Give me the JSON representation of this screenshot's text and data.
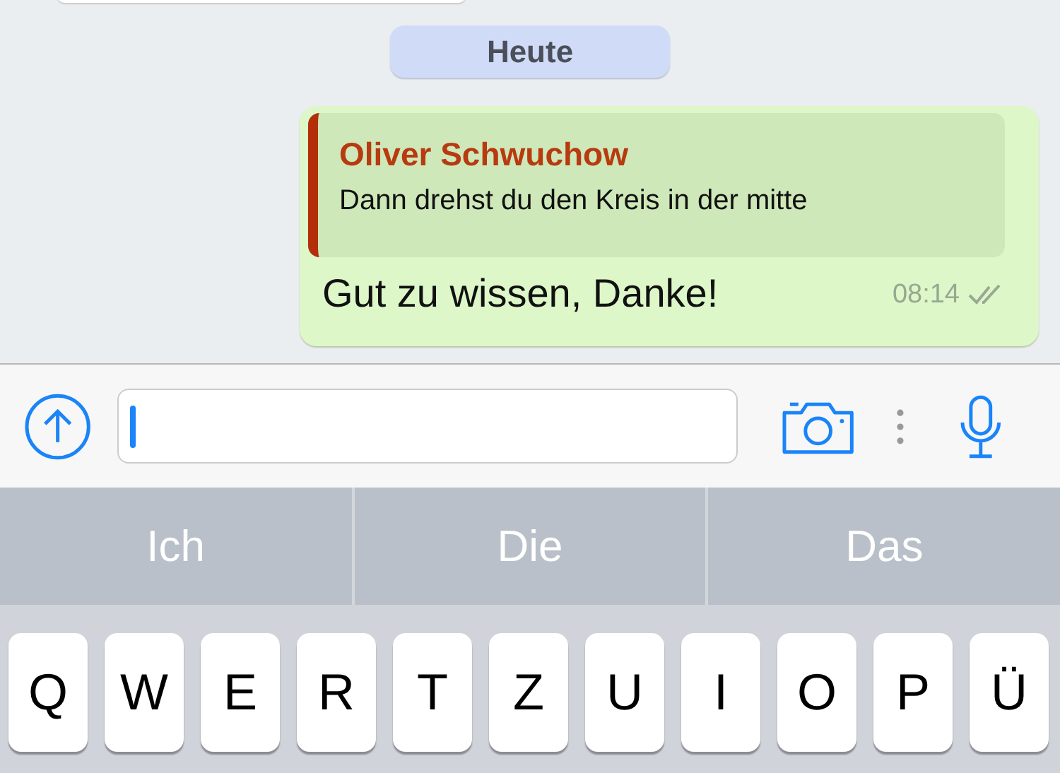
{
  "date_chip": "Heute",
  "message": {
    "outgoing": true,
    "quote": {
      "author": "Oliver Schwuchow",
      "text": "Dann drehst du den Kreis in der mitte"
    },
    "text": "Gut zu wissen, Danke!",
    "time": "08:14"
  },
  "suggestions": [
    "Ich",
    "Die",
    "Das"
  ],
  "keys": [
    "Q",
    "W",
    "E",
    "R",
    "T",
    "Z",
    "U",
    "I",
    "O",
    "P",
    "Ü"
  ]
}
